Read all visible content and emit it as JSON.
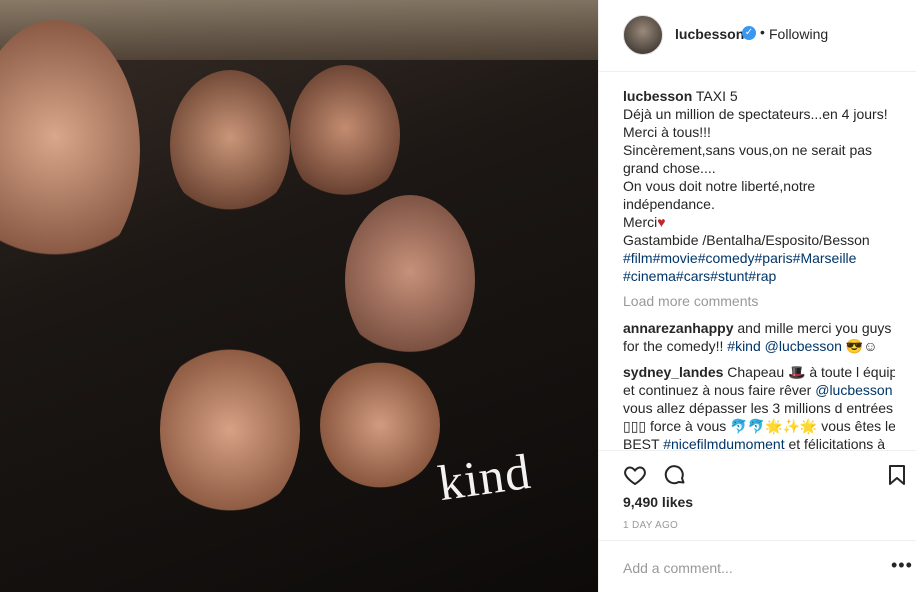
{
  "post": {
    "image_text": "kind"
  },
  "header": {
    "username": "lucbesson",
    "separator": "•",
    "follow_status": "Following"
  },
  "caption": {
    "username": "lucbesson",
    "first": "TAXI 5",
    "lines": [
      "Déjà un million de spectateurs...en 4 jours!",
      "Merci à tous!!!",
      "Sincèrement,sans vous,on ne serait pas",
      "grand chose....",
      "On vous doit notre liberté,notre",
      "indépendance.",
      "Merci",
      "Gastambide /Bentalha/Esposito/Besson"
    ],
    "merci_heart": "♥",
    "hashtags_line1": [
      "#film",
      "#movie",
      "#comedy",
      "#paris",
      "#Marseille"
    ],
    "hashtags_line2": [
      "#cinema",
      "#cars",
      "#stunt",
      "#rap"
    ]
  },
  "load_more": "Load more comments",
  "comments": [
    {
      "username": "annarezanhappy",
      "parts": [
        " and mille merci you guys",
        "for the comedy!! ",
        "#kind",
        " ",
        "@lucbesson",
        " 😎☺"
      ]
    },
    {
      "username": "sydney_landes",
      "parts": [
        " Chapeau 🎩 à toute l équipe",
        "et continuez à nous faire rêver ",
        "@lucbesson",
        "vous allez dépasser les 3 millions d entrées",
        "▯▯▯ force à vous 🐬🐬🌟✨🌟 vous êtes le",
        "BEST ",
        "#nicefilmdumoment",
        " et félicitations à"
      ]
    }
  ],
  "actions": {
    "like_icon": "heart-outline-icon",
    "comment_icon": "speech-bubble-icon",
    "save_icon": "bookmark-icon"
  },
  "likes": "9,490 likes",
  "time_ago": "1 DAY AGO",
  "add_comment": {
    "placeholder": "Add a comment...",
    "more": "•••"
  }
}
